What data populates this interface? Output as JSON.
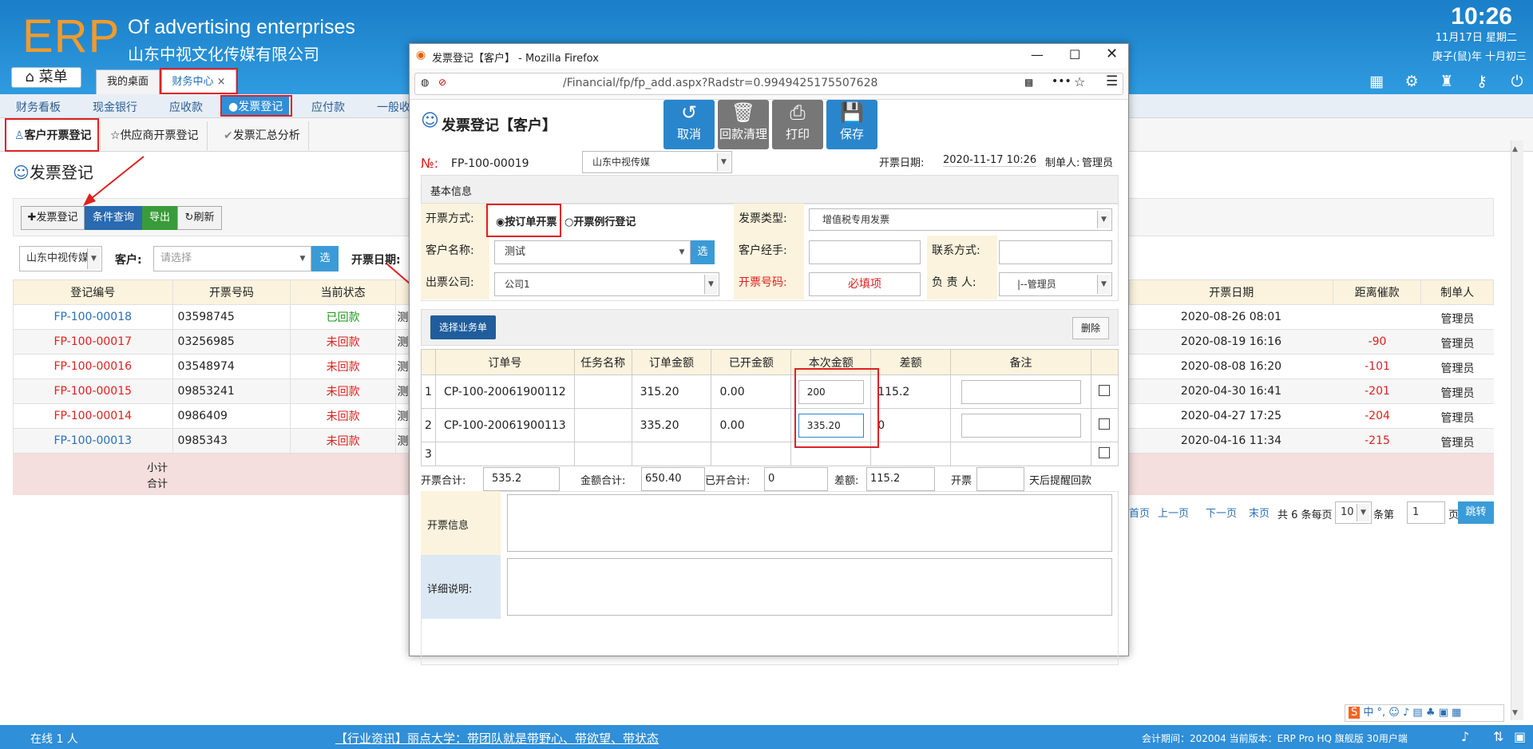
{
  "app": {
    "logo": "ERP",
    "brand_en": "Of advertising enterprises",
    "brand_cn": "山东中视文化传媒有限公司",
    "clock": "10:26",
    "date": "11月17日 星期二",
    "lunar": "庚子(鼠)年 十月初三",
    "menu_label": "菜单",
    "tabs": [
      {
        "label": "我的桌面"
      },
      {
        "label": "财务中心"
      }
    ],
    "close_glyph": "×"
  },
  "nav2": [
    "财务看板",
    "现金银行",
    "应收款",
    "●发票登记",
    "应付款",
    "一般收"
  ],
  "subtabs": [
    "客户开票登记",
    "供应商开票登记",
    "发票汇总分析"
  ],
  "page": {
    "title": "发票登记",
    "toolbar": [
      "✚发票登记",
      "条件查询",
      "导出",
      "↻刷新"
    ],
    "company_select": "山东中视传媒",
    "customer_label": "客户:",
    "customer_placeholder": "请选择",
    "select_btn": "选",
    "date_label": "开票日期:"
  },
  "table": {
    "headers_left": [
      "登记编号",
      "开票号码",
      "当前状态"
    ],
    "headers_right": [
      "开票日期",
      "距离催款",
      "制单人"
    ],
    "rows": [
      {
        "id": "FP-100-00018",
        "no": "03598745",
        "status": "已回款",
        "extra": "测",
        "date": "2020-08-26 08:01",
        "overdue": "",
        "maker": "管理员"
      },
      {
        "id": "FP-100-00017",
        "no": "03256985",
        "status": "未回款",
        "extra": "测",
        "date": "2020-08-19 16:16",
        "overdue": "-90",
        "maker": "管理员"
      },
      {
        "id": "FP-100-00016",
        "no": "03548974",
        "status": "未回款",
        "extra": "测",
        "date": "2020-08-08 16:20",
        "overdue": "-101",
        "maker": "管理员"
      },
      {
        "id": "FP-100-00015",
        "no": "09853241",
        "status": "未回款",
        "extra": "测",
        "date": "2020-04-30 16:41",
        "overdue": "-201",
        "maker": "管理员"
      },
      {
        "id": "FP-100-00014",
        "no": "0986409",
        "status": "未回款",
        "extra": "测",
        "date": "2020-04-27 17:25",
        "overdue": "-204",
        "maker": "管理员"
      },
      {
        "id": "FP-100-00013",
        "no": "0985343",
        "status": "未回款",
        "extra": "测",
        "date": "2020-04-16 11:34",
        "overdue": "-215",
        "maker": "管理员"
      }
    ],
    "subtotal": "小计",
    "total": "合计"
  },
  "pager": {
    "first": "首页",
    "prev": "上一页",
    "next": "下一页",
    "last": "末页",
    "info": "共 6 条每页",
    "per_page": "10",
    "per_suffix": "条第",
    "page": "1",
    "page_suffix": "页",
    "go": "跳转"
  },
  "modal": {
    "window_title": "发票登记【客户】 - Mozilla Firefox",
    "url": "/Financial/fp/fp_add.aspx?Radstr=0.9949425175507628",
    "heading": "发票登记【客户】",
    "actions": [
      "取消",
      "回款清理",
      "打印",
      "保存"
    ],
    "no_label": "№:",
    "no_value": "FP-100-00019",
    "company": "山东中视传媒",
    "date_label": "开票日期:",
    "date_value": "2020-11-17 10:26",
    "maker_label": "制单人:",
    "maker_value": "管理员",
    "section_basic": "基本信息",
    "method_label": "开票方式:",
    "method_opt1": "按订单开票",
    "method_opt2": "开票例行登记",
    "type_label": "发票类型:",
    "type_value": "增值税专用发票",
    "customer_label": "客户名称:",
    "customer_value": "测试",
    "select_btn": "选",
    "handler_label": "客户经手:",
    "contact_label": "联系方式:",
    "issuer_label": "出票公司:",
    "issuer_value": "公司1",
    "invoice_no_label": "开票号码:",
    "invoice_no_value": "必填项",
    "owner_label": "负 责 人:",
    "owner_value": "|--管理员",
    "pick_btn": "选择业务单",
    "delete_btn": "删除",
    "order_headers": [
      "订单号",
      "任务名称",
      "订单金额",
      "已开金额",
      "本次金额",
      "差额",
      "备注"
    ],
    "orders": [
      {
        "n": "1",
        "order": "CP-100-20061900112",
        "task": "",
        "amount": "315.20",
        "issued": "0.00",
        "current": "200",
        "diff": "115.2"
      },
      {
        "n": "2",
        "order": "CP-100-20061900113",
        "task": "",
        "amount": "335.20",
        "issued": "0.00",
        "current": "335.20",
        "diff": "0"
      },
      {
        "n": "3",
        "order": "",
        "task": "",
        "amount": "",
        "issued": "",
        "current": "",
        "diff": ""
      }
    ],
    "sum_invoice_label": "开票合计:",
    "sum_invoice": "535.2",
    "sum_amount_label": "金额合计:",
    "sum_amount": "650.40",
    "sum_issued_label": "已开合计:",
    "sum_issued": "0",
    "sum_diff_label": "差额:",
    "sum_diff": "115.2",
    "remind_prefix": "开票",
    "remind_suffix": "天后提醒回款",
    "info_label": "开票信息",
    "desc_label": "详细说明:"
  },
  "footer": {
    "online": "在线  1  人",
    "news": "【行业资讯】丽点大学：带团队就是带野心、带欲望、带状态",
    "version": "会计期间：202004 当前版本：ERP Pro HQ 旗舰版 30用户端"
  },
  "colors": {
    "header": "#2f9be0",
    "accent": "#f39a2b",
    "red": "#e02020",
    "blue_btn": "#3a9bd6"
  }
}
